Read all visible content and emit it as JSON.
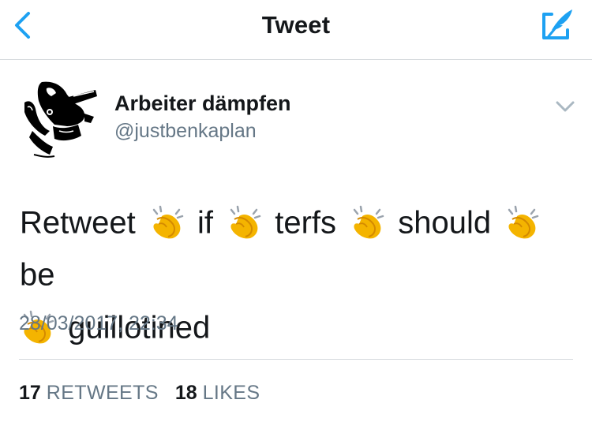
{
  "colors": {
    "accent": "#1da1f2",
    "text": "#14171a",
    "secondary": "#657786",
    "divider": "#d5d9dd"
  },
  "navbar": {
    "title": "Tweet",
    "back_icon": "chevron-left-icon",
    "compose_icon": "compose-quill-icon"
  },
  "tweet": {
    "author": {
      "name": "Arbeiter dämpfen",
      "handle": "@justbenkaplan",
      "avatar_icon": "boot-stomping-avatar"
    },
    "menu_icon": "chevron-down-icon",
    "text_parts": [
      "Retweet",
      "if",
      "terfs",
      "should",
      "be",
      "guillotined"
    ],
    "emoji": "clapping-hands-emoji",
    "timestamp": "28/03/2017, 22:34",
    "stats": {
      "retweets_count": "17",
      "retweets_label": "RETWEETS",
      "likes_count": "18",
      "likes_label": "LIKES"
    }
  }
}
